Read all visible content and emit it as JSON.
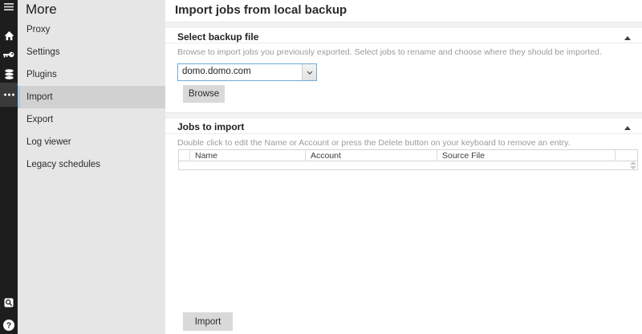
{
  "rail": {
    "icons": [
      {
        "name": "menu-icon",
        "selected": false
      },
      {
        "name": "home-icon",
        "selected": false
      },
      {
        "name": "key-icon",
        "selected": false
      },
      {
        "name": "database-icon",
        "selected": false
      },
      {
        "name": "more-icon",
        "selected": true,
        "glyph": "•••"
      }
    ],
    "bottom_icons": [
      {
        "name": "search-icon"
      },
      {
        "name": "help-icon",
        "glyph": "?"
      }
    ]
  },
  "sidebar": {
    "title": "More",
    "items": [
      {
        "label": "Proxy",
        "selected": false
      },
      {
        "label": "Settings",
        "selected": false
      },
      {
        "label": "Plugins",
        "selected": false
      },
      {
        "label": "Import",
        "selected": true
      },
      {
        "label": "Export",
        "selected": false
      },
      {
        "label": "Log viewer",
        "selected": false
      },
      {
        "label": "Legacy schedules",
        "selected": false
      }
    ]
  },
  "main": {
    "title": "Import jobs from local backup",
    "sections": [
      {
        "header": "Select backup file",
        "collapse_icon": "collapse-up-icon",
        "description": "Browse to import jobs you previously exported. Select jobs to rename and choose where they should be imported.",
        "combobox": {
          "value": "domo.domo.com",
          "dropdown_icon": "chevron-down-icon"
        },
        "browse_label": "Browse"
      },
      {
        "header": "Jobs to import",
        "collapse_icon": "collapse-up-icon",
        "description": "Double click to edit the Name or Account or press the Delete button on your keyboard to remove an entry.",
        "table": {
          "columns": [
            "Name",
            "Account",
            "Source File"
          ],
          "rows": []
        }
      }
    ],
    "import_label": "Import"
  },
  "colors": {
    "rail_bg": "#1d1d1d",
    "rail_selected_bg": "#3a3a3a",
    "sidebar_bg": "#e6e6e6",
    "sidebar_selected_bg": "#d1d1d1",
    "selection_accent_blue": "#a5cde8",
    "combobox_border_blue": "#71abd3",
    "button_bg": "#d9d9d9",
    "section_divider": "#f2f2f2"
  }
}
